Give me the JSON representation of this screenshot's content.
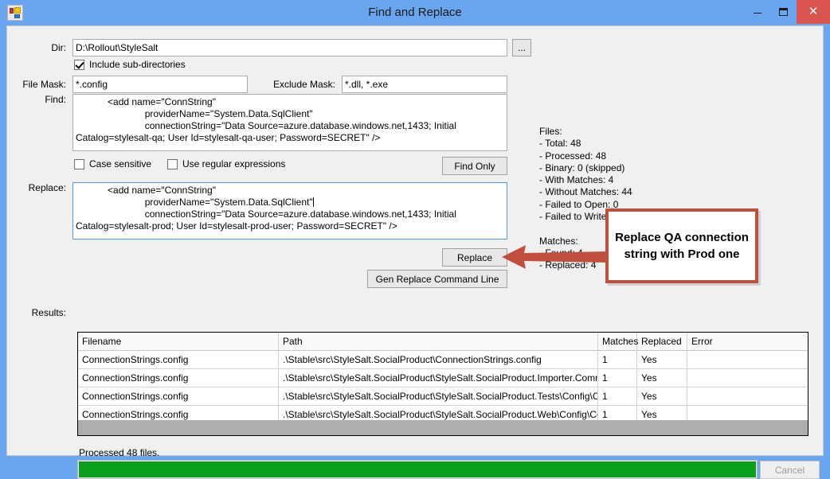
{
  "window": {
    "title": "Find and Replace",
    "icon": "app-icon",
    "controls": {
      "minimize": "–",
      "maximize": "⬜",
      "close": "✕"
    }
  },
  "form": {
    "dir": {
      "label": "Dir:",
      "value": "D:\\Rollout\\StyleSalt",
      "browse_label": "..."
    },
    "include_subdirs": {
      "label": "Include sub-directories",
      "checked": true
    },
    "file_mask": {
      "label": "File Mask:",
      "value": "*.config"
    },
    "exclude_mask": {
      "label": "Exclude Mask:",
      "value": "*.dll, *.exe"
    },
    "find": {
      "label": "Find:",
      "value": "            <add name=\"ConnString\"\n                          providerName=\"System.Data.SqlClient\"\n                          connectionString=\"Data Source=azure.database.windows.net,1433; Initial Catalog=stylesalt-qa; User Id=stylesalt-qa-user; Password=SECRET\" />"
    },
    "case_sensitive": {
      "label": "Case sensitive",
      "checked": false
    },
    "use_regex": {
      "label": "Use regular expressions",
      "checked": false
    },
    "find_only_label": "Find Only",
    "replace": {
      "label": "Replace:",
      "value": "            <add name=\"ConnString\"\n                          providerName=\"System.Data.SqlClient\"\n                          connectionString=\"Data Source=azure.database.windows.net,1433; Initial Catalog=stylesalt-prod; User Id=stylesalt-prod-user; Password=SECRET\" />"
    },
    "replace_label": "Replace",
    "gen_cmd_label": "Gen Replace Command Line",
    "results_label": "Results:"
  },
  "stats": {
    "text": "Files:\n- Total: 48\n- Processed: 48\n- Binary: 0 (skipped)\n- With Matches: 4\n- Without Matches: 44\n- Failed to Open: 0\n- Failed to Write: 0\n\nMatches:\n- Found: 4\n- Replaced: 4"
  },
  "results": {
    "columns": [
      "Filename",
      "Path",
      "Matches",
      "Replaced",
      "Error"
    ],
    "rows": [
      {
        "filename": "ConnectionStrings.config",
        "path": ".\\Stable\\src\\StyleSalt.SocialProduct\\ConnectionStrings.config",
        "matches": "1",
        "replaced": "Yes",
        "error": ""
      },
      {
        "filename": "ConnectionStrings.config",
        "path": ".\\Stable\\src\\StyleSalt.SocialProduct\\StyleSalt.SocialProduct.Importer.Command...",
        "matches": "1",
        "replaced": "Yes",
        "error": ""
      },
      {
        "filename": "ConnectionStrings.config",
        "path": ".\\Stable\\src\\StyleSalt.SocialProduct\\StyleSalt.SocialProduct.Tests\\Config\\Conn...",
        "matches": "1",
        "replaced": "Yes",
        "error": ""
      },
      {
        "filename": "ConnectionStrings.config",
        "path": ".\\Stable\\src\\StyleSalt.SocialProduct\\StyleSalt.SocialProduct.Web\\Config\\Conn...",
        "matches": "1",
        "replaced": "Yes",
        "error": ""
      }
    ]
  },
  "status": {
    "message": "Processed 48 files.",
    "progress_percent": 100,
    "cancel_label": "Cancel",
    "cancel_enabled": false
  },
  "annotation": {
    "text": "Replace QA connection string with Prod one",
    "color": "#c0503d"
  },
  "colors": {
    "titlebar": "#6aa6ef",
    "close_button": "#d9534f",
    "client": "#f0f0f0",
    "progress": "#0aa01e",
    "focus_border": "#5b9bd5",
    "annotation": "#c0503d"
  }
}
